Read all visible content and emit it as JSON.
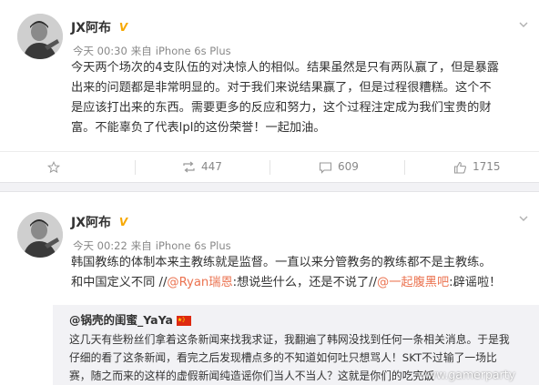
{
  "posts": [
    {
      "author": "JX阿布",
      "verified_badge": "V",
      "time": "今天 00:30",
      "source_prefix": "来自",
      "source": "iPhone 6s Plus",
      "text_lines": [
        "今天两个场次的4支队伍的对决惊人的相似。结果虽然是只有两队赢了，但是暴露",
        "出来的问题都是非常明显的。对于我们来说结果赢了，但是过程很糟糕。这个不",
        "是应该打出来的东西。需要更多的反应和努力，这个过程注定成为我们宝贵的财",
        "富。不能辜负了代表lpl的这份荣誉！一起加油。"
      ],
      "actions": {
        "favorite_icon": "star-icon",
        "repost_icon": "repost-icon",
        "repost_count": "447",
        "comment_icon": "comment-icon",
        "comment_count": "609",
        "like_icon": "thumbs-up-icon",
        "like_count": "1715"
      }
    },
    {
      "author": "JX阿布",
      "verified_badge": "V",
      "time": "今天 00:22",
      "source_prefix": "来自",
      "source": "iPhone 6s Plus",
      "text_line1": "韩国教练的体制本来主教练就是监督。一直以来分管教务的教练都不是主教练。",
      "text_line2": {
        "part1": "和中国定义不同 //",
        "mention1": "@Ryan瑞恩",
        "part2": ":想说些什么，还是不说了//",
        "mention2": "@一起腹黑吧",
        "part3": ":辟谣啦！"
      },
      "repost": {
        "author": "@锅壳的闺蜜_YaYa",
        "flag_icon": "china-flag-icon",
        "text_lines": [
          "这几天有些粉丝们拿着这条新闻来找我求证，我翻遍了韩网没找到任何一条相关消息。于是我",
          "仔细的看了这条新闻，看完之后发现槽点多的不知道如何吐只想骂人！SKT不过输了一场比",
          "赛，随之而来的这样的虚假新闻纯造谣你们当人不当人？这就是你们的吃完饭"
        ]
      }
    }
  ],
  "watermark": "www.gamerparty",
  "colors": {
    "mention": "#eb7350",
    "verified": "#f7a800",
    "meta": "#888888",
    "separator": "#f2f2f5"
  }
}
